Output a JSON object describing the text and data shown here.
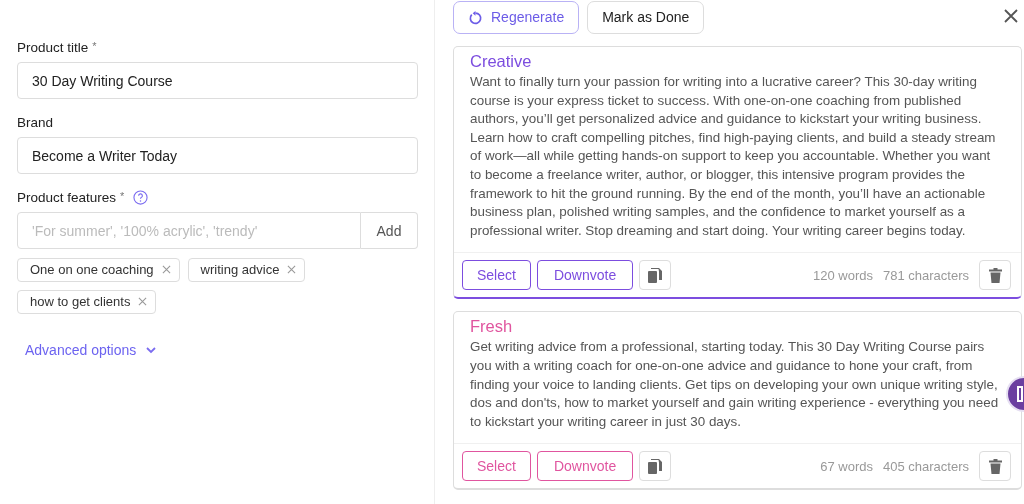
{
  "form": {
    "title_label": "Product title",
    "title_required": "*",
    "title_value": "30 Day Writing Course",
    "brand_label": "Brand",
    "brand_value": "Become a Writer Today",
    "features_label": "Product features",
    "features_required": "*",
    "features_placeholder": "'For summer', '100% acrylic', 'trendy'",
    "add_button": "Add",
    "tags": [
      "One on one coaching",
      "writing advice",
      "how to get clients"
    ],
    "advanced_options": "Advanced options"
  },
  "toolbar": {
    "regenerate": "Regenerate",
    "mark_done": "Mark as Done"
  },
  "results": [
    {
      "title": "Creative",
      "color": "#7c4ddf",
      "selected": true,
      "text": "Want to finally turn your passion for writing into a lucrative career? This 30-day writing course is your express ticket to success. With one-on-one coaching from published authors, you’ll get personalized advice and guidance to kickstart your writing business. Learn how to craft compelling pitches, find high-paying clients, and build a steady stream of work—all while getting hands-on support to keep you accountable. Whether you want to become a freelance writer, author, or blogger, this intensive program provides the framework to hit the ground running. By the end of the month, you’ll have an actionable business plan, polished writing samples, and the confidence to market yourself as a professional writer. Stop dreaming and start doing. Your writing career begins today.",
      "select": "Select",
      "downvote": "Downvote",
      "words": "120 words",
      "characters": "781 characters"
    },
    {
      "title": "Fresh",
      "color": "#e0559f",
      "selected": false,
      "text": "Get writing advice from a professional, starting today. This 30 Day Writing Course pairs you with a writing coach for one-on-one advice and guidance to hone your craft, from finding your voice to landing clients. Get tips on developing your own unique writing style, dos and don'ts, how to market yourself and gain writing experience - everything you need to kickstart your writing career in just 30 days.",
      "select": "Select",
      "downvote": "Downvote",
      "words": "67 words",
      "characters": "405 characters"
    }
  ]
}
